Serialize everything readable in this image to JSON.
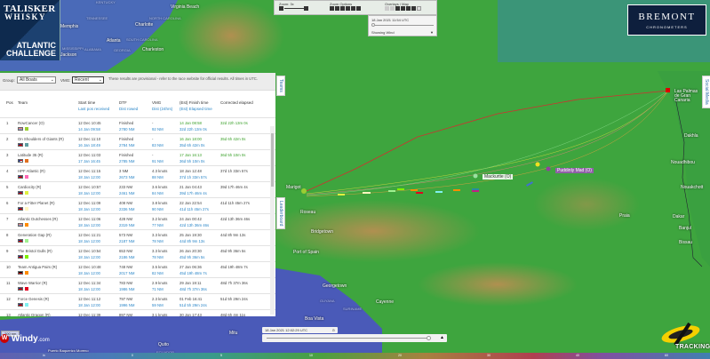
{
  "logo": {
    "line1": "TALISKER",
    "line2": "WHISKY",
    "line3": "ATLANTIC",
    "line4": "CHALLENGE"
  },
  "controls": {
    "zoom_label": "Zoom: 3x",
    "zoom_options_label": "Zoom Options",
    "overlays_label": "Overlays / Map",
    "map_time": "18 Jan 2021 11:54 UTC",
    "showing": "Showing Wind"
  },
  "sponsor": {
    "name": "BREMONT",
    "sub": "CHRONOMETERS"
  },
  "filters": {
    "group_label": "Group:",
    "group_value": "All Boats",
    "vmg_label": "VMG:",
    "vmg_value": "Recent",
    "notice": "These results are provisional - refer to the race website for official results. All times in UTC."
  },
  "headers": {
    "pos": "Pos",
    "team": "Team",
    "start": "Start time",
    "lastpos": "Last pos received",
    "dtf": "DTF",
    "dist_rowed": "Dist rowed",
    "vmg": "VMG",
    "dist24": "Dist (24hrs)",
    "finish": "(Est) Finish time",
    "elapsed": "(Est) Elapsed time",
    "corrected": "Corrected elapsed"
  },
  "rows": [
    {
      "pos": "1",
      "team": "RowCancer (O)",
      "flag": "nl",
      "color": "#9acd32",
      "start": "12 Dec 10:45",
      "lastpos": "14 Jan 09:58",
      "dtf": "Finished",
      "dist": "2780 NM",
      "vmg": "-",
      "dist24": "92 NM",
      "finish": "14 Jan 08:58",
      "elapsed": "32d 22h 13m 0s",
      "corrected": "32d 22h 13m 0s",
      "finished": true
    },
    {
      "pos": "2",
      "team": "On Shoulders of Giants (R)",
      "flag": "uk",
      "color": "#5f9ea0",
      "start": "12 Dec 11:10",
      "lastpos": "16 Jan 18:49",
      "dtf": "Finished",
      "dist": "2784 NM",
      "vmg": "-",
      "dist24": "83 NM",
      "finish": "16 Jan 18:00",
      "elapsed": "35d 6h 42m 0s",
      "corrected": "35d 6h 42m 0s",
      "finished": true
    },
    {
      "pos": "3",
      "team": "Latitude 35 (R)",
      "flag": "us",
      "color": "#e07020",
      "start": "12 Dec 11:03",
      "lastpos": "17 Jan 16:45",
      "dtf": "Finished",
      "dist": "2785 NM",
      "vmg": "-",
      "dist24": "91 NM",
      "finish": "17 Jan 16:13",
      "elapsed": "36d 5h 10m 0s",
      "corrected": "36d 5h 10m 0s",
      "finished": true
    },
    {
      "pos": "4",
      "team": "HPF Atlantic (R)",
      "flag": "uk",
      "color": "#ff69b4",
      "start": "12 Dec 11:15",
      "lastpos": "18 Jan 12:00",
      "dtf": "3 NM",
      "dist": "2673 NM",
      "vmg": "4.3 knots",
      "dist24": "88 NM",
      "finish": "18 Jan 12:48",
      "elapsed": "37d 1h 33m 57s",
      "corrected": "37d 1h 33m 57s",
      "finished": false
    },
    {
      "pos": "5",
      "team": "Cardiocity (R)",
      "flag": "uk",
      "color": "#e0f040",
      "start": "12 Dec 10:57",
      "lastpos": "18 Jan 12:00",
      "dtf": "233 NM",
      "dist": "2461 NM",
      "vmg": "3.6 knots",
      "dist24": "84 NM",
      "finish": "21 Jan 04:43",
      "elapsed": "39d 17h 46m 4s",
      "corrected": "39d 17h 46m 4s",
      "finished": false
    },
    {
      "pos": "6",
      "team": "For a Fitter Planet (R)",
      "flag": "uk",
      "color": "#fff6c0",
      "start": "12 Dec 11:09",
      "lastpos": "18 Jan 12:00",
      "dtf": "408 NM",
      "dist": "2336 NM",
      "vmg": "3.8 knots",
      "dist24": "90 NM",
      "finish": "22 Jan 22:54",
      "elapsed": "41d 11h 45m 27s",
      "corrected": "41d 11h 45m 27s",
      "finished": false
    },
    {
      "pos": "7",
      "team": "Atlantic Dutchesses (R)",
      "flag": "nl",
      "color": "#ff8c00",
      "start": "12 Dec 11:06",
      "lastpos": "18 Jan 12:00",
      "dtf": "428 NM",
      "dist": "2319 NM",
      "vmg": "3.2 knots",
      "dist24": "77 NM",
      "finish": "24 Jan 00:42",
      "elapsed": "42d 13h 36m 46s",
      "corrected": "42d 13h 36m 46s",
      "finished": false
    },
    {
      "pos": "8",
      "team": "Generation Gap (R)",
      "flag": "uk",
      "color": "#a0f090",
      "start": "12 Dec 11:21",
      "lastpos": "18 Jan 12:00",
      "dtf": "573 NM",
      "dist": "2187 NM",
      "vmg": "3.3 knots",
      "dist24": "78 NM",
      "finish": "25 Jan 19:30",
      "elapsed": "44d 8h 9m 13s",
      "corrected": "44d 8h 9m 13s",
      "finished": false
    },
    {
      "pos": "9",
      "team": "The Bristol Gulls (R)",
      "flag": "uk",
      "color": "#80f000",
      "start": "12 Dec 10:54",
      "lastpos": "18 Jan 12:00",
      "dtf": "653 NM",
      "dist": "2186 NM",
      "vmg": "3.3 knots",
      "dist24": "78 NM",
      "finish": "26 Jan 20:30",
      "elapsed": "45d 9h 36m 5s",
      "corrected": "45d 9h 36m 5s",
      "finished": false
    },
    {
      "pos": "10",
      "team": "Team Antigua Pairs (R)",
      "flag": "ag",
      "color": "#ff8c00",
      "start": "12 Dec 10:48",
      "lastpos": "18 Jan 12:00",
      "dtf": "748 NM",
      "dist": "2017 NM",
      "vmg": "3.5 knots",
      "dist24": "82 NM",
      "finish": "27 Jan 06:36",
      "elapsed": "45d 19h 48m 7s",
      "corrected": "45d 19h 48m 7s",
      "finished": false
    },
    {
      "pos": "11",
      "team": "Wave Warrior (R)",
      "flag": "uk",
      "color": "#e00020",
      "start": "12 Dec 11:34",
      "lastpos": "18 Jan 12:00",
      "dtf": "783 NM",
      "dist": "1986 NM",
      "vmg": "2.9 knots",
      "dist24": "71 NM",
      "finish": "29 Jan 19:11",
      "elapsed": "48d 7h 37m 36s",
      "corrected": "48d 7h 37m 36s",
      "finished": false
    },
    {
      "pos": "12",
      "team": "Force Genesis (R)",
      "flag": "uk",
      "color": "#80f0f0",
      "start": "12 Dec 11:12",
      "lastpos": "18 Jan 12:00",
      "dtf": "797 NM",
      "dist": "1996 NM",
      "vmg": "2.3 knots",
      "dist24": "59 NM",
      "finish": "01 Feb 16:41",
      "elapsed": "51d 5h 29m 24s",
      "corrected": "51d 5h 29m 24s",
      "finished": false
    },
    {
      "pos": "13",
      "team": "Atlantic Dragon (R)",
      "flag": "uk",
      "color": "#cccccc",
      "start": "12 Dec 11:39",
      "lastpos": "",
      "dtf": "897 NM",
      "dist": "",
      "vmg": "3.1 knots",
      "dist24": "",
      "finish": "30 Jan 17:43",
      "elapsed": "",
      "corrected": "48d 6h 4m 11s",
      "finished": false
    }
  ],
  "tabs": {
    "teams": "Teams",
    "leaderboard": "Leaderboard",
    "social": "Social Media"
  },
  "map": {
    "labels": [
      "Virginia Beach",
      "Charlotte",
      "NORTH CAROLINA",
      "SOUTH CAROLINA",
      "Atlanta",
      "GEORGIA",
      "Charleston",
      "TENNESSEE",
      "Memphis",
      "ALABAMA",
      "MISSISSIPPI",
      "Jackson",
      "KENTUCKY",
      "Las Palmas de Gran Canaria",
      "Dakhla",
      "Nouadhibou",
      "Nouakchott",
      "Dakar",
      "Banjul",
      "Bissau",
      "Praia",
      "Marigot",
      "Roseau",
      "Bridgetown",
      "Port of Spain",
      "Georgetown",
      "GUYANA",
      "SURINAME",
      "Cayenne",
      "Boa Vista",
      "Quito",
      "ECUADOR",
      "Mitu",
      "Puerto Baquerizo Moreno"
    ],
    "markers": {
      "mackurtie": "Mackurtie (O)",
      "puddle": "Puddinly Mad (O)"
    },
    "scale": "200 nm"
  },
  "timeline": {
    "time": "18 Jan 2021 12:02:29 UTC"
  },
  "windy": {
    "brand": "Windy",
    "suffix": ".com"
  },
  "tracker": {
    "label": "TRACKING"
  },
  "color_scale": [
    "in",
    "0",
    "5",
    "10",
    "20",
    "30",
    "40",
    "60"
  ]
}
